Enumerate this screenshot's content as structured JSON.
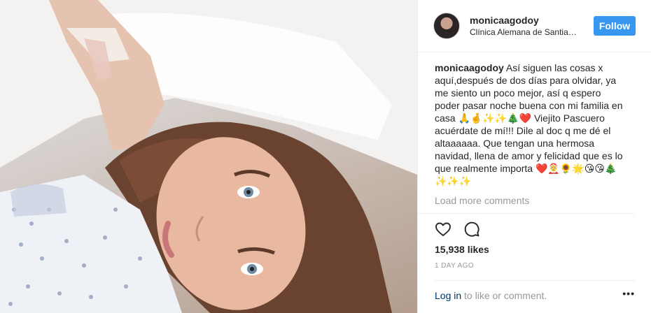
{
  "post": {
    "username": "monicaagodoy",
    "location": "Clínica Alemana de Santiago",
    "follow_label": "Follow",
    "caption_user": "monicaagodoy",
    "caption_text": "Así siguen las cosas x aquí,después de dos días para olvidar, ya me siento un poco mejor, así q espero poder pasar noche buena con mi familia en casa 🙏🤞✨✨🎄❤️ Viejito Pascuero acuérdate de mí!!! Dile al doc q me dé el altaaaaaa. Que tengan una hermosa navidad, llena de amor y felicidad que es lo que realmente importa ❤️🤶🌻🌟😘😘🎄✨✨✨",
    "load_more": "Load more comments",
    "likes": "15,938 likes",
    "time": "1 DAY AGO",
    "login_link": "Log in",
    "login_suffix": " to like or comment.",
    "more_label": "•••"
  },
  "icons": {
    "like": "heart-icon",
    "comment": "comment-icon",
    "more": "more-options-icon"
  },
  "colors": {
    "accent": "#3897f0",
    "link": "#003569",
    "muted": "#999999"
  }
}
